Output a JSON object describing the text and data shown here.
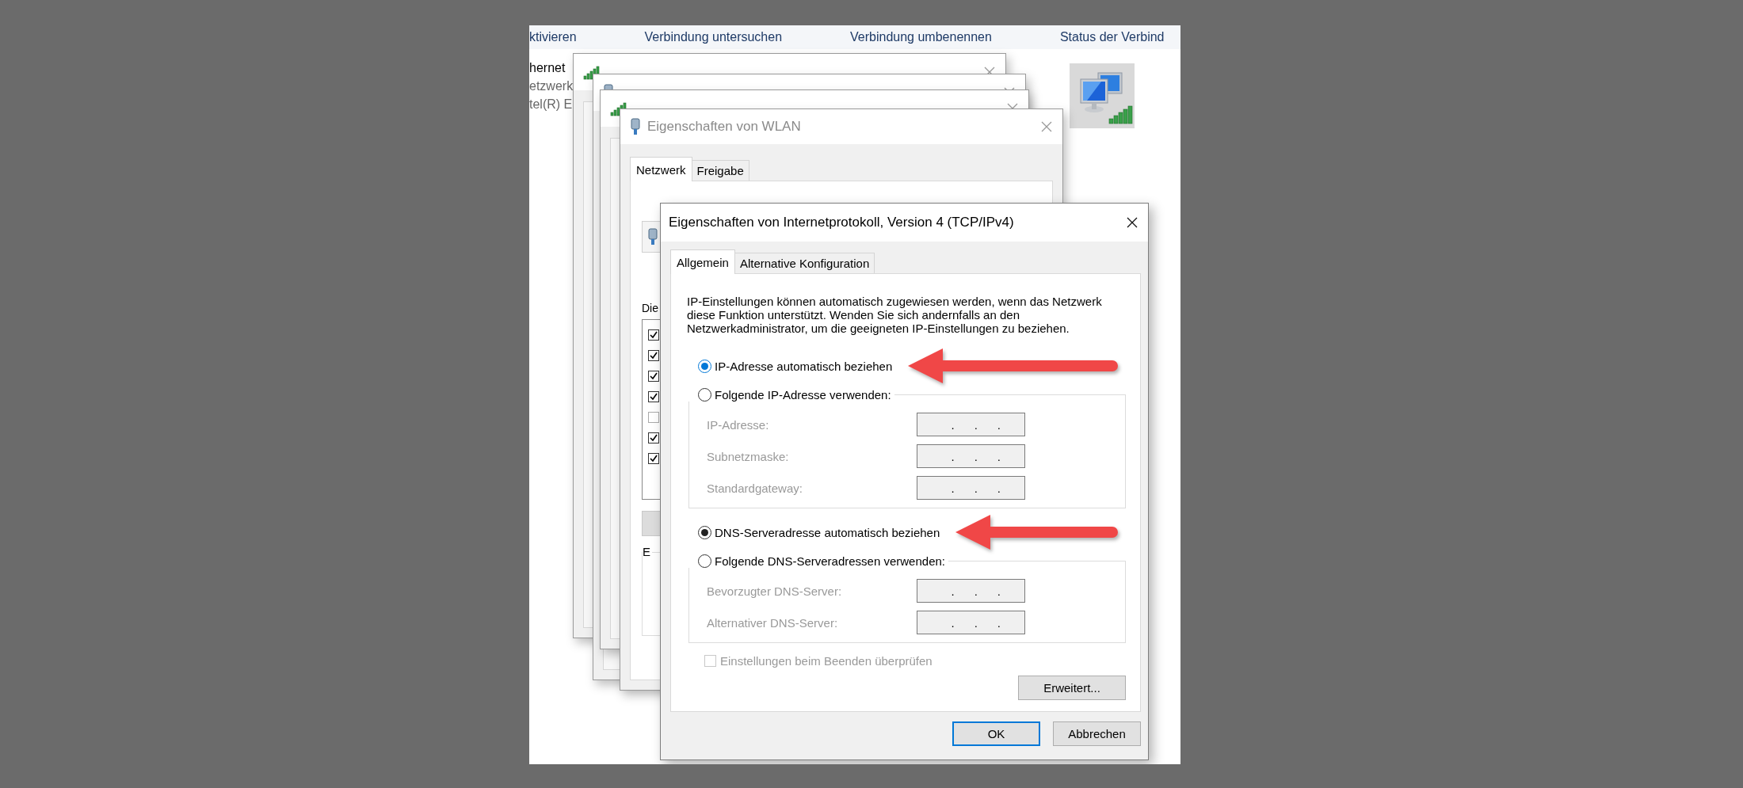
{
  "toolbar": {
    "items": [
      "ktivieren",
      "Verbindung untersuchen",
      "Verbindung umbenennen",
      "Status der Verbind"
    ]
  },
  "connection": {
    "name": "hernet",
    "lines": [
      "etzwerk",
      "tel(R) E"
    ]
  },
  "windows": [
    {
      "kind": "status"
    },
    {
      "kind": "properties"
    },
    {
      "kind": "status"
    },
    {
      "kind": "properties",
      "title": "Eigenschaften von WLAN",
      "tabs": [
        {
          "label": "Netzwerk",
          "selected": true
        },
        {
          "label": "Freigabe",
          "selected": false
        }
      ],
      "list_label": "Die",
      "components": [
        {
          "checked": true
        },
        {
          "checked": true
        },
        {
          "checked": true
        },
        {
          "checked": true
        },
        {
          "checked": false
        },
        {
          "checked": true
        },
        {
          "checked": true
        }
      ],
      "group_label": "E"
    }
  ],
  "dialog": {
    "title": "Eigenschaften von Internetprotokoll, Version 4 (TCP/IPv4)",
    "tabs": [
      {
        "label": "Allgemein",
        "selected": true
      },
      {
        "label": "Alternative Konfiguration",
        "selected": false
      }
    ],
    "description": "IP-Einstellungen können automatisch zugewiesen werden, wenn das Netzwerk diese Funktion unterstützt. Wenden Sie sich andernfalls an den Netzwerkadministrator, um die geeigneten IP-Einstellungen zu beziehen.",
    "ip_options": [
      {
        "label": "IP-Adresse automatisch beziehen",
        "selected": true,
        "focused": true,
        "arrow": true
      },
      {
        "label": "Folgende IP-Adresse verwenden:",
        "selected": false,
        "focused": false,
        "arrow": false
      }
    ],
    "ip_fields": [
      {
        "label": "IP-Adresse:",
        "value": ".      .      .",
        "disabled": true
      },
      {
        "label": "Subnetzmaske:",
        "value": ".      .      .",
        "disabled": true
      },
      {
        "label": "Standardgateway:",
        "value": ".      .      .",
        "disabled": true
      }
    ],
    "dns_options": [
      {
        "label": "DNS-Serveradresse automatisch beziehen",
        "selected": true,
        "focused": false,
        "arrow": true
      },
      {
        "label": "Folgende DNS-Serveradressen verwenden:",
        "selected": false,
        "focused": false,
        "arrow": false
      }
    ],
    "dns_fields": [
      {
        "label": "Bevorzugter DNS-Server:",
        "value": ".      .      .",
        "disabled": true
      },
      {
        "label": "Alternativer DNS-Server:",
        "value": ".      .      .",
        "disabled": true
      }
    ],
    "validate": {
      "label": "Einstellungen beim Beenden überprüfen",
      "checked": false,
      "disabled": true
    },
    "advanced_button": "Erweitert...",
    "buttons": [
      {
        "label": "OK",
        "default": true
      },
      {
        "label": "Abbrechen",
        "default": false
      }
    ]
  }
}
